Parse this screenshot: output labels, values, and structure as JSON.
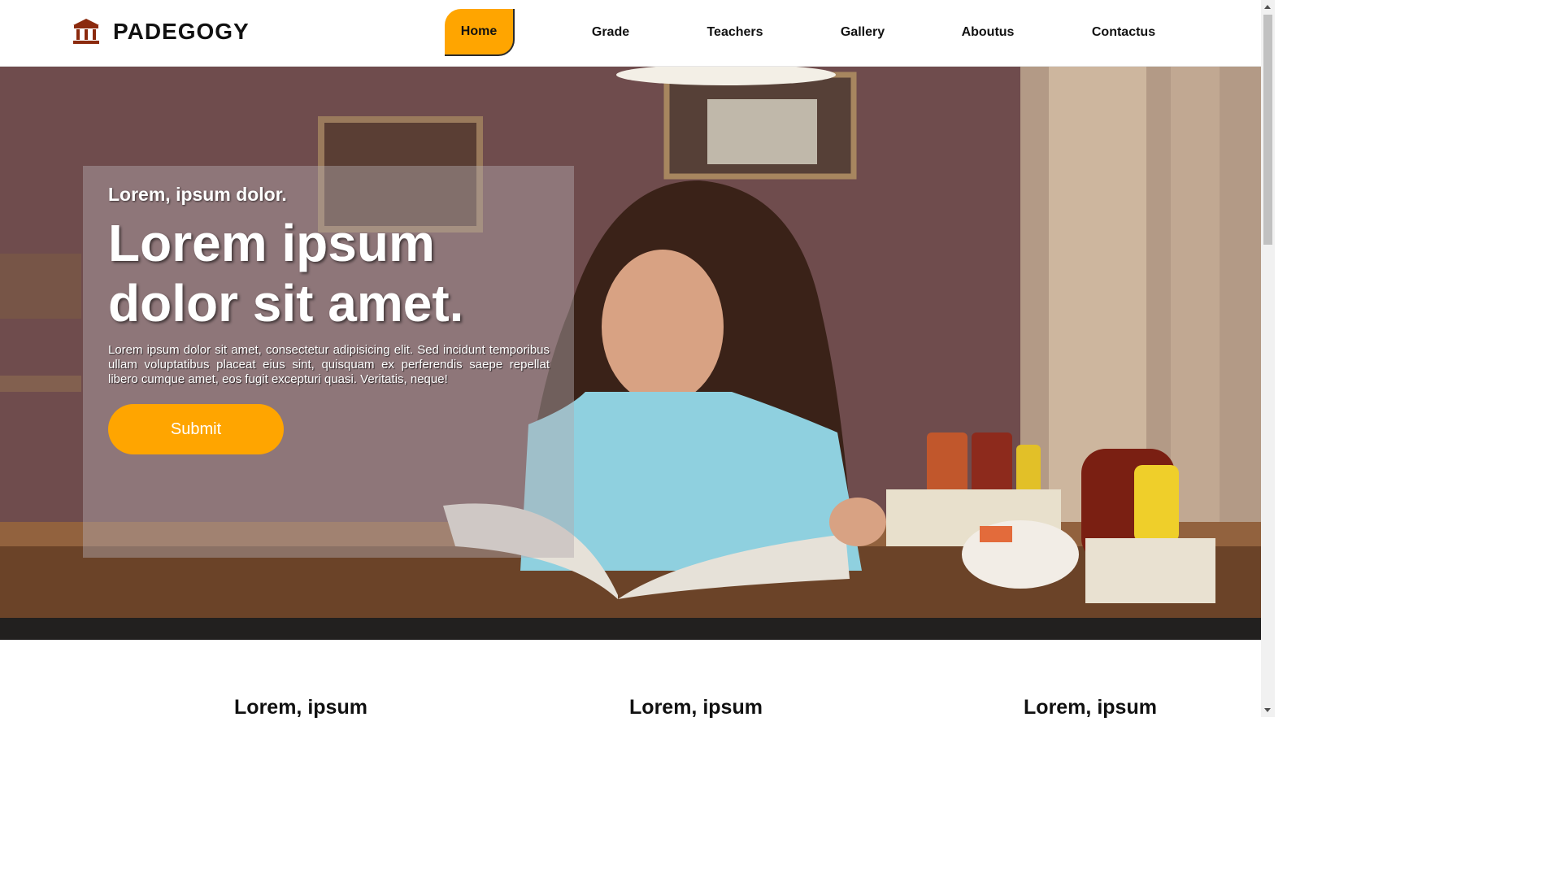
{
  "brand": {
    "name": "PADEGOGY",
    "icon": "bank-building-icon",
    "icon_color": "#8b2a0e"
  },
  "nav": {
    "items": [
      {
        "label": "Home",
        "active": true
      },
      {
        "label": "Grade",
        "active": false
      },
      {
        "label": "Teachers",
        "active": false
      },
      {
        "label": "Gallery",
        "active": false
      },
      {
        "label": "Aboutus",
        "active": false
      },
      {
        "label": "Contactus",
        "active": false
      }
    ]
  },
  "hero": {
    "kicker": "Lorem, ipsum dolor.",
    "title": "Lorem ipsum dolor sit amet.",
    "text": "Lorem ipsum dolor sit amet, consectetur adipisicing elit. Sed incidunt temporibus ullam voluptatibus placeat eius sint, quisquam ex perferendis saepe repellat libero cumque amet, eos fugit excepturi quasi. Veritatis, neque!",
    "button_label": "Submit"
  },
  "features": {
    "headings": [
      "Lorem, ipsum",
      "Lorem, ipsum",
      "Lorem, ipsum"
    ]
  },
  "colors": {
    "accent": "#ffa500",
    "text": "#111111"
  }
}
